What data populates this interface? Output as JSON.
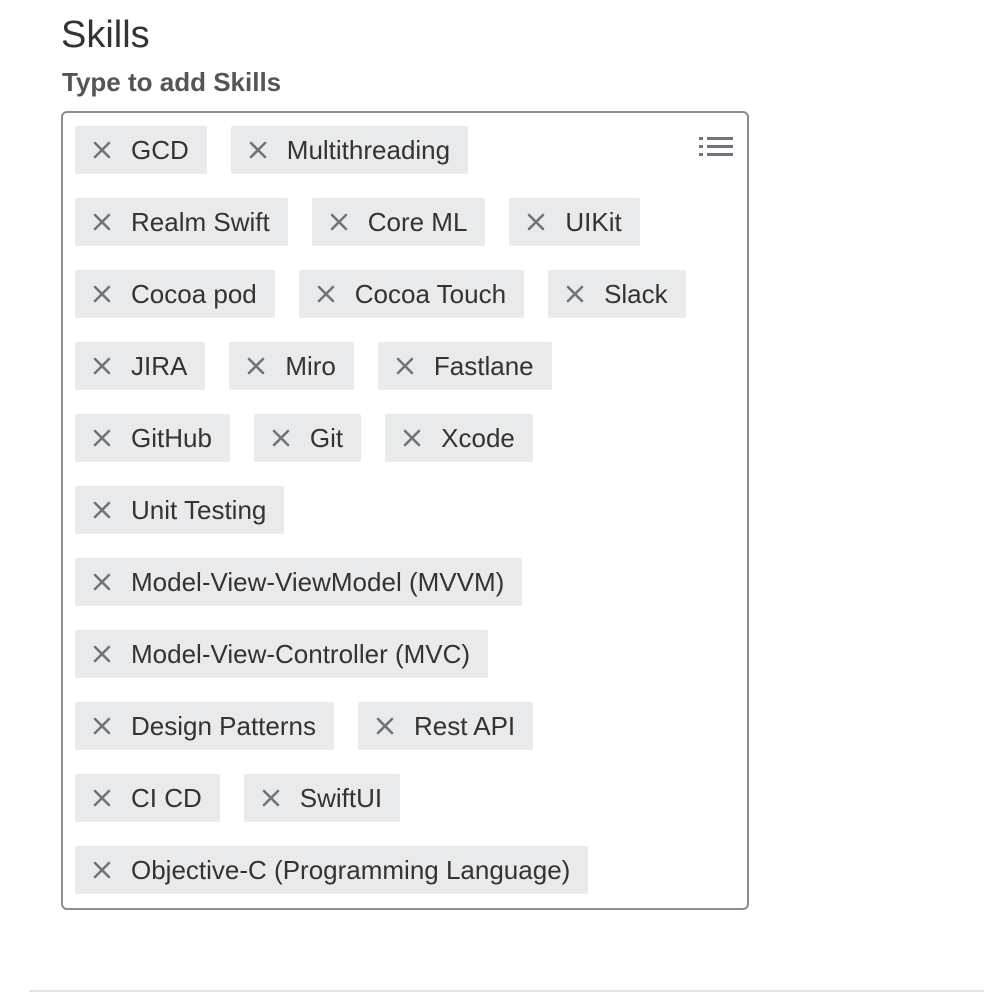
{
  "section": {
    "title": "Skills",
    "input_label": "Type to add Skills"
  },
  "icons": {
    "remove": "close-icon",
    "list_toggle": "list-icon"
  },
  "colors": {
    "chip_background": "#e9eaec",
    "icon": "#6f747a",
    "border": "#8a8d92"
  },
  "skills": [
    {
      "label": "GCD"
    },
    {
      "label": "Multithreading"
    },
    {
      "label": "Realm Swift"
    },
    {
      "label": "Core ML"
    },
    {
      "label": "UIKit"
    },
    {
      "label": "Cocoa pod"
    },
    {
      "label": "Cocoa Touch"
    },
    {
      "label": "Slack"
    },
    {
      "label": "JIRA"
    },
    {
      "label": "Miro"
    },
    {
      "label": "Fastlane"
    },
    {
      "label": "GitHub"
    },
    {
      "label": "Git"
    },
    {
      "label": "Xcode"
    },
    {
      "label": "Unit Testing"
    },
    {
      "label": "Model-View-ViewModel (MVVM)"
    },
    {
      "label": "Model-View-Controller (MVC)"
    },
    {
      "label": "Design Patterns"
    },
    {
      "label": "Rest API"
    },
    {
      "label": "CI CD"
    },
    {
      "label": "SwiftUI"
    },
    {
      "label": "Objective-C (Programming Language)"
    }
  ]
}
